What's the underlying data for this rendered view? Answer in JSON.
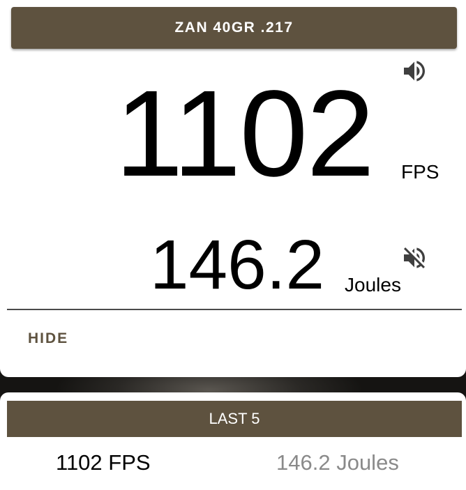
{
  "header": {
    "title": "ZAN 40GR .217"
  },
  "reading": {
    "velocity": "1102",
    "velocity_unit": "FPS",
    "energy": "146.2",
    "energy_unit": "Joules"
  },
  "sound": {
    "velocity_icon": "speaker-volume-icon",
    "energy_icon": "speaker-muted-icon"
  },
  "actions": {
    "hide_label": "HIDE"
  },
  "history": {
    "title": "LAST 5",
    "rows": [
      {
        "velocity": "1102",
        "velocity_unit": "FPS",
        "energy": "146.2",
        "energy_unit": "Joules"
      }
    ]
  },
  "colors": {
    "accent": "#5e523f",
    "muted_text": "#8a8a8a"
  }
}
